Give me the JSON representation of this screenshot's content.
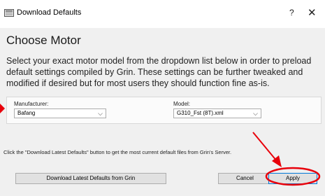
{
  "window": {
    "title": "Download Defaults",
    "help_label": "?",
    "close_label": "✕"
  },
  "header": {
    "title": "Choose Motor",
    "description": "Select your exact motor model from the dropdown list below in order to preload default settings compiled by Grin. These settings can be further tweaked and modified if desired but for most users they should function fine as-is."
  },
  "form": {
    "manufacturer_label": "Manufacturer:",
    "manufacturer_value": "Bafang",
    "model_label": "Model:",
    "model_value": "G310_Fst (8T).xml"
  },
  "hint": "Click the \"Download Latest Defaults\" button to get the most current default files from Grin's Server.",
  "buttons": {
    "download_label": "Download Latest Defaults from Grin",
    "cancel_label": "Cancel",
    "apply_label": "Apply"
  },
  "annotations": {
    "arrow_color": "#e8000b",
    "circle_color": "#e8000b"
  }
}
